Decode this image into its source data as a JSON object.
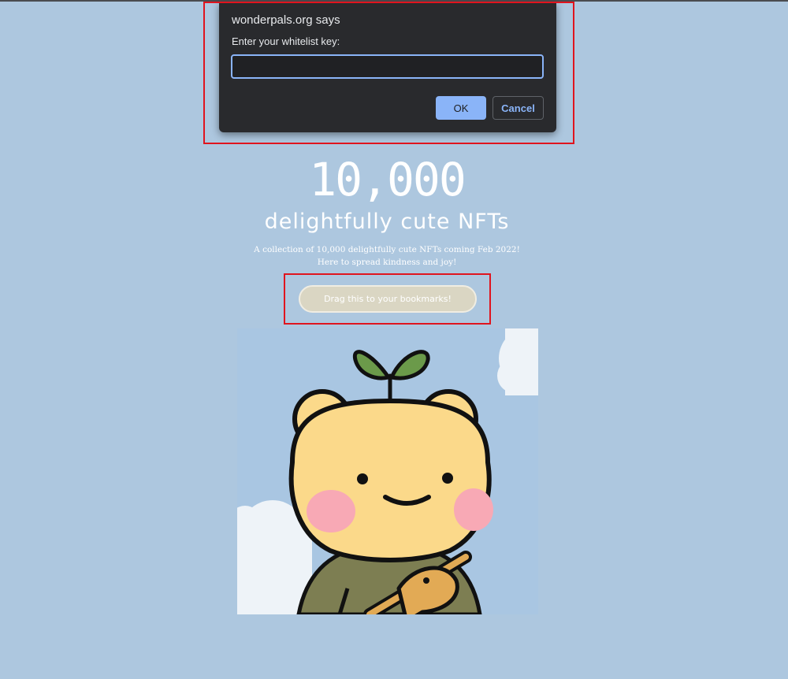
{
  "dialog": {
    "title": "wonderpals.org says",
    "message": "Enter your whitelist key:",
    "input_value": "",
    "input_placeholder": "",
    "ok_label": "OK",
    "cancel_label": "Cancel"
  },
  "hero": {
    "number": "10,000",
    "subtitle": "delightfully cute NFTs",
    "description_line1": "A collection of 10,000 delightfully cute NFTs coming Feb 2022!",
    "description_line2": "Here to spread kindness and joy!",
    "bookmark_button_label": "Drag this to your bookmarks!"
  },
  "colors": {
    "page_background": "#adc7df",
    "dialog_background": "#292a2d",
    "dialog_accent": "#8ab4f8",
    "annotation_red": "#e0141e",
    "bookmark_button": "#dad6c3",
    "character_face": "#fbd98a",
    "character_cheeks": "#f8a9b5",
    "character_sprout": "#6b9a4a",
    "character_shirt": "#7d7e52"
  },
  "icons": {
    "artwork": "bear-with-sprout-illustration"
  }
}
